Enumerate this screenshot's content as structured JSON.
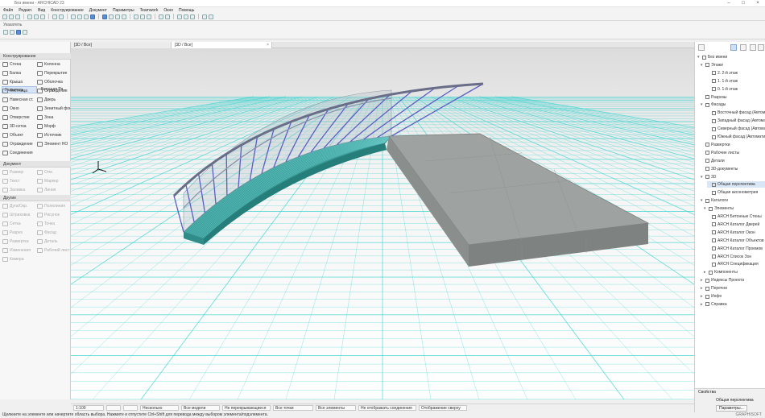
{
  "window": {
    "title": "Без имени - ARCHICAD 23"
  },
  "menu": [
    "Файл",
    "Редакт.",
    "Вид",
    "Конструирование",
    "Документ",
    "Параметры",
    "Teamwork",
    "Окно",
    "Помощь"
  ],
  "infobox": {
    "label": "Указатель"
  },
  "tabs": [
    {
      "label": "[3D / Все]"
    },
    {
      "label": "[3D / Все]"
    }
  ],
  "toolbox": {
    "select_label": "Указатель",
    "marquee_label": "Бегущая Ра...",
    "section_design": "Конструирование",
    "design_items": [
      [
        "Стена",
        "Колонна"
      ],
      [
        "Балка",
        "Перекрытие"
      ],
      [
        "Крыша",
        "Оболочка"
      ],
      [
        "Лестница",
        "Ограждение"
      ],
      [
        "Навесная ст.",
        "Дверь"
      ],
      [
        "Окно",
        "Зенитный фон..."
      ],
      [
        "Отверстие",
        "Зона"
      ],
      [
        "3D-сетка",
        "Морф"
      ],
      [
        "Объект",
        "Источник"
      ],
      [
        "Ограждение",
        "Элемент НО"
      ],
      [
        "Соединения",
        ""
      ]
    ],
    "section_doc": "Документ",
    "doc_items": [
      [
        "Размер",
        "Отм."
      ],
      [
        "Текст",
        "Маркер"
      ],
      [
        "Заливка",
        "Линия"
      ]
    ],
    "section_more": "Другие",
    "more_items": [
      [
        "Дуга/Окр.",
        "Полилиния"
      ],
      [
        "Штриховка",
        "Рисунок"
      ],
      [
        "Сетка",
        "Точка"
      ],
      [
        "Разрез",
        "Фасад"
      ],
      [
        "Развертка",
        "Деталь"
      ],
      [
        "Изменения",
        "Рабочий лист"
      ],
      [
        "Камера",
        ""
      ]
    ]
  },
  "navigator": {
    "items": [
      {
        "text": "Без имени",
        "indent": 0,
        "arrow": "▾"
      },
      {
        "text": "Этажи",
        "indent": 1,
        "arrow": "▾"
      },
      {
        "text": "2. 2-й этаж",
        "indent": 3,
        "arrow": ""
      },
      {
        "text": "1. 1-й этаж",
        "indent": 3,
        "arrow": ""
      },
      {
        "text": "0. 1-й этаж",
        "indent": 3,
        "arrow": ""
      },
      {
        "text": "Разрезы",
        "indent": 1,
        "arrow": ""
      },
      {
        "text": "Фасады",
        "indent": 1,
        "arrow": "▾"
      },
      {
        "text": "Восточный фасад (Автоматич...",
        "indent": 3,
        "arrow": ""
      },
      {
        "text": "Западный фасад (Автоматич...",
        "indent": 3,
        "arrow": ""
      },
      {
        "text": "Северный фасад (Автоматич...",
        "indent": 3,
        "arrow": ""
      },
      {
        "text": "Южный фасад (Автоматич...",
        "indent": 3,
        "arrow": ""
      },
      {
        "text": "Развертки",
        "indent": 1,
        "arrow": ""
      },
      {
        "text": "Рабочие листы",
        "indent": 1,
        "arrow": ""
      },
      {
        "text": "Детали",
        "indent": 1,
        "arrow": ""
      },
      {
        "text": "3D-документы",
        "indent": 1,
        "arrow": ""
      },
      {
        "text": "3D",
        "indent": 1,
        "arrow": "▾"
      },
      {
        "text": "Общая перспектива",
        "indent": 3,
        "arrow": "",
        "selected": true
      },
      {
        "text": "Общая аксонометрия",
        "indent": 3,
        "arrow": ""
      },
      {
        "text": "Каталоги",
        "indent": 1,
        "arrow": "▾"
      },
      {
        "text": "Элементы",
        "indent": 2,
        "arrow": "▾"
      },
      {
        "text": "ARCH Бетонные Стены",
        "indent": 3,
        "arrow": ""
      },
      {
        "text": "ARCH Каталог Дверей",
        "indent": 3,
        "arrow": ""
      },
      {
        "text": "ARCH Каталог Окон",
        "indent": 3,
        "arrow": ""
      },
      {
        "text": "ARCH Каталог Объектов",
        "indent": 3,
        "arrow": ""
      },
      {
        "text": "ARCH Каталог Проемов",
        "indent": 3,
        "arrow": ""
      },
      {
        "text": "ARCH Список Зон",
        "indent": 3,
        "arrow": ""
      },
      {
        "text": "ARCH Спецификация",
        "indent": 3,
        "arrow": ""
      },
      {
        "text": "Компоненты",
        "indent": 2,
        "arrow": "▸"
      },
      {
        "text": "Индексы Проекта",
        "indent": 1,
        "arrow": "▸"
      },
      {
        "text": "Перечни",
        "indent": 1,
        "arrow": "▸"
      },
      {
        "text": "Инфо",
        "indent": 1,
        "arrow": "▸"
      },
      {
        "text": "Справка",
        "indent": 1,
        "arrow": "▸"
      }
    ]
  },
  "properties": {
    "header": "Свойства",
    "view_name": "Общая перспектива",
    "settings_button": "Параметры..."
  },
  "statusbar": {
    "fields": [
      "1:100",
      "",
      "",
      "Несколько",
      "Все модели",
      "Не перекрывающиеся",
      "Все точки",
      "Все элементы",
      "Не отображать соединения",
      "Отображение сверху"
    ]
  },
  "hint": "Щелкните на элементе или начертите область выбора. Нажмите и отпустите Ctrl+Shift для перевода между выбором элемента/подэлемента.",
  "badge": "GRAPHISOFT",
  "colors": {
    "grid_line": "#3fd4d0",
    "grid_bg": "#ffffff",
    "concrete": "#9a9e9c",
    "ramp": "#3aa7a3",
    "rail": "#6b6f8f"
  }
}
